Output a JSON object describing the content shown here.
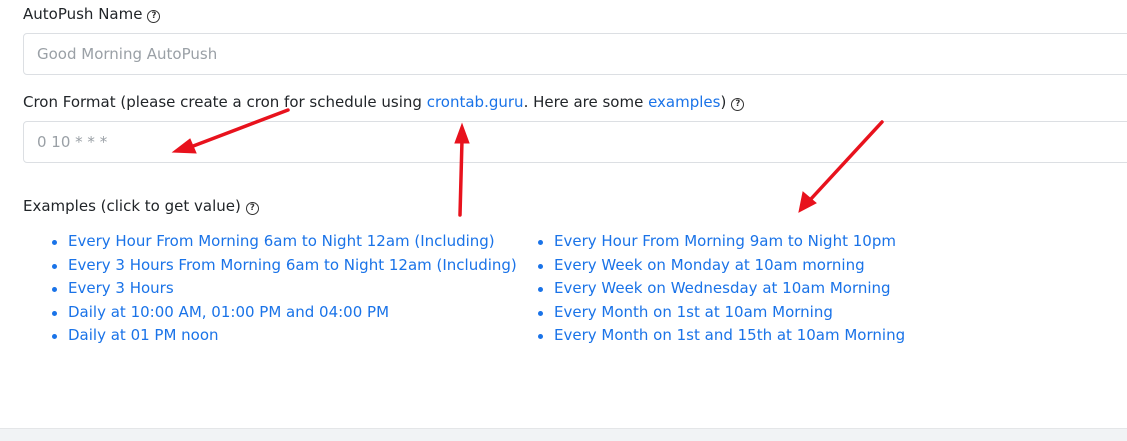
{
  "name_field": {
    "label": "AutoPush Name",
    "help_icon": "?",
    "placeholder": "Good Morning AutoPush"
  },
  "cron_field": {
    "label_prefix": "Cron Format (please create a cron for schedule using ",
    "link_crontab": "crontab.guru",
    "label_middle": ". Here are some ",
    "link_examples": "examples",
    "label_suffix": ")",
    "help_icon": "?",
    "placeholder": "0 10 * * *"
  },
  "examples": {
    "title": "Examples (click to get value)",
    "help_icon": "?",
    "left": [
      "Every Hour From Morning 6am to Night 12am (Including)",
      "Every 3 Hours From Morning 6am to Night 12am (Including)",
      "Every 3 Hours",
      "Daily at 10:00 AM, 01:00 PM and 04:00 PM",
      "Daily at 01 PM noon"
    ],
    "right": [
      "Every Hour From Morning 9am to Night 10pm",
      "Every Week on Monday at 10am morning",
      "Every Week on Wednesday at 10am Morning",
      "Every Month on 1st at 10am Morning",
      "Every Month on 1st and 15th at 10am Morning"
    ]
  },
  "annotation_color": "#e8121d",
  "link_color": "#1a73e8"
}
